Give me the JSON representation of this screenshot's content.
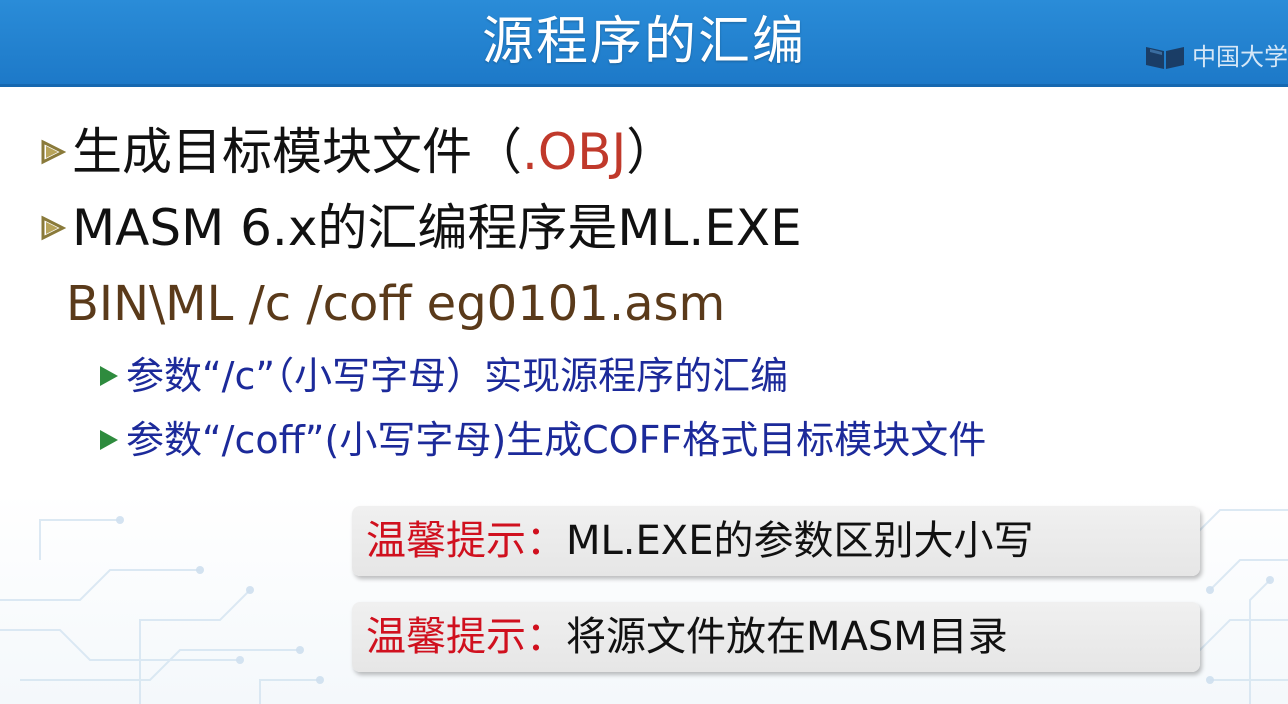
{
  "header": {
    "title": "源程序的汇编",
    "logo_text": "中国大学"
  },
  "bullets": [
    {
      "text": "生成目标模块文件（",
      "accent": ".OBJ",
      "suffix": "）"
    },
    {
      "text": "MASM 6.x的汇编程序是ML.EXE"
    }
  ],
  "command": "BIN\\ML /c /coff eg0101.asm",
  "sub_bullets": [
    {
      "text": "参数“/c”（小写字母）实现源程序的汇编"
    },
    {
      "text": "参数“/coff”(小写字母)生成COFF格式目标模块文件"
    }
  ],
  "tips": [
    {
      "label": "温馨提示：",
      "text": "ML.EXE的参数区别大小写"
    },
    {
      "label": "温馨提示：",
      "text": "将源文件放在MASM目录"
    }
  ],
  "colors": {
    "header_bg": "#1d79c8",
    "accent_red": "#c0392b",
    "command_brown": "#5a3a1a",
    "sub_blue": "#1c2a9a",
    "tip_red": "#d0101e",
    "bullet_olive": "#8a7a3a",
    "sub_bullet_green": "#2e8b3e"
  },
  "icons": {
    "bullet": "triangle-bullet-icon",
    "sub_bullet": "small-triangle-bullet-icon",
    "logo": "book-logo-icon"
  }
}
